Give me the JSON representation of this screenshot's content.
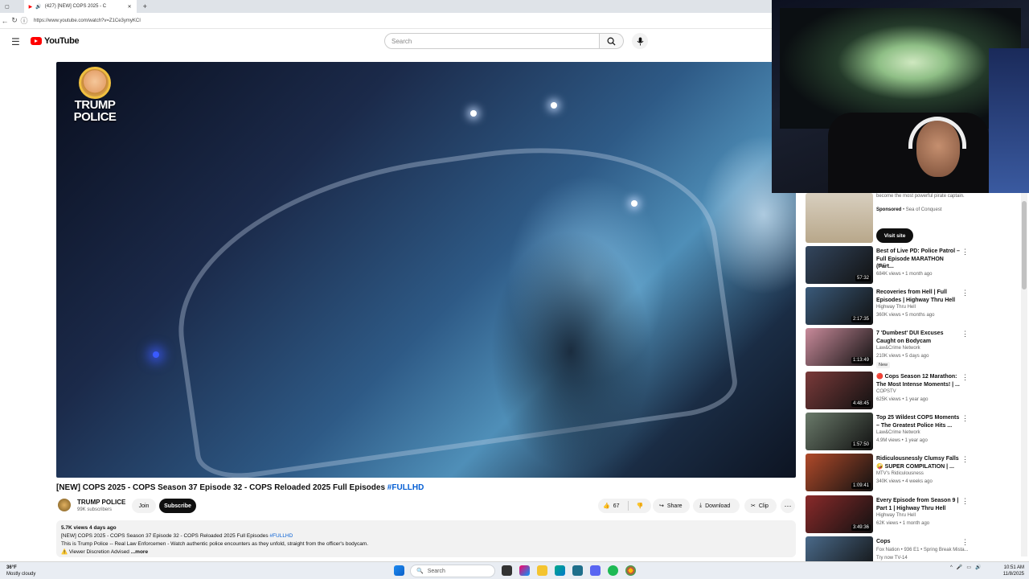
{
  "browser": {
    "tab_title": "(427) [NEW] COPS 2025 - C",
    "url": "https://www.youtube.com/watch?v=Z1Ce3ymyKCI"
  },
  "header": {
    "logo_text": "YouTube",
    "search_placeholder": "Search"
  },
  "video": {
    "overlay_line1": "TRUMP",
    "overlay_line2": "POLICE",
    "title": "[NEW] COPS 2025 - COPS Season 37 Episode 32 - COPS Reloaded 2025 Full Episodes",
    "title_tag": "#FULLHD"
  },
  "channel": {
    "name": "TRUMP POLICE",
    "subs": "99K subscribers",
    "join_label": "Join",
    "subscribe_label": "Subscribe"
  },
  "actions": {
    "likes": "67",
    "share": "Share",
    "download": "Download",
    "clip": "Clip"
  },
  "description": {
    "meta": "5.7K views  4 days ago",
    "line1": "[NEW] COPS 2025 - COPS Season 37 Episode 32 - COPS Reloaded 2025 Full Episodes",
    "line1_tag": "#FULLHD",
    "line2": "This is Trump Police -- Real Law Enforcemen - Watch authentic police encounters as they unfold, straight from the officer's bodycam.",
    "line3": "⚠️ Viewer Discretion Advised",
    "more": "...more"
  },
  "ad": {
    "desc": "become the most powerful pirate captain.",
    "sponsored": "Sponsored",
    "advertiser": "Sea of Conquest",
    "visit": "Visit site"
  },
  "recommendations": [
    {
      "title": "Best of Live PD: Police Patrol – Full Episode MARATHON (Part...",
      "channel": "A&E",
      "views": "684K views • 1 month ago",
      "duration": "57:32",
      "color": "#33465e"
    },
    {
      "title": "Recoveries from Hell | Full Episodes | Highway Thru Hell",
      "channel": "Highway Thru Hell",
      "views": "360K views • 5 months ago",
      "duration": "2:17:35",
      "color": "#3a5a7a"
    },
    {
      "title": "7 'Dumbest' DUI Excuses Caught on Bodycam",
      "channel": "Law&Crime Network",
      "views": "210K views • 5 days ago",
      "duration": "1:13:49",
      "color": "#c88a9a",
      "badge": "New"
    },
    {
      "title": "🔴 Cops Season 12 Marathon: The Most Intense Moments! | ...",
      "channel": "COPSTV",
      "views": "625K views • 1 year ago",
      "duration": "4:48:45",
      "color": "#7a3a3a"
    },
    {
      "title": "Top 25 Wildest COPS Moments – The Greatest Police Hits ...",
      "channel": "Law&Crime Network",
      "views": "4.9M views • 1 year ago",
      "duration": "1:57:50",
      "color": "#6a7a6a"
    },
    {
      "title": "Ridiculousnessly Clumsy Falls 🤪 SUPER COMPILATION | ...",
      "channel": "MTV's Ridiculousness",
      "views": "340K views • 4 weeks ago",
      "duration": "1:09:41",
      "color": "#b04a2a"
    },
    {
      "title": "Every Episode from Season 9 | Part 1 | Highway Thru Hell",
      "channel": "Highway Thru Hell",
      "views": "62K views • 1 month ago",
      "duration": "3:49:36",
      "color": "#8a2a2a"
    },
    {
      "title": "Cops",
      "channel": "Fox Nation • 936 E1 • Spring Break Mista...",
      "views": "Try now  TV-14",
      "duration": "",
      "color": "#4a6a8a"
    }
  ],
  "taskbar": {
    "temp": "36°F",
    "weather": "Mostly cloudy",
    "search": "Search",
    "time": "10:51 AM",
    "date": "11/8/2025"
  },
  "colors": {
    "brand_red": "#ff0000",
    "link_blue": "#065fd4"
  }
}
